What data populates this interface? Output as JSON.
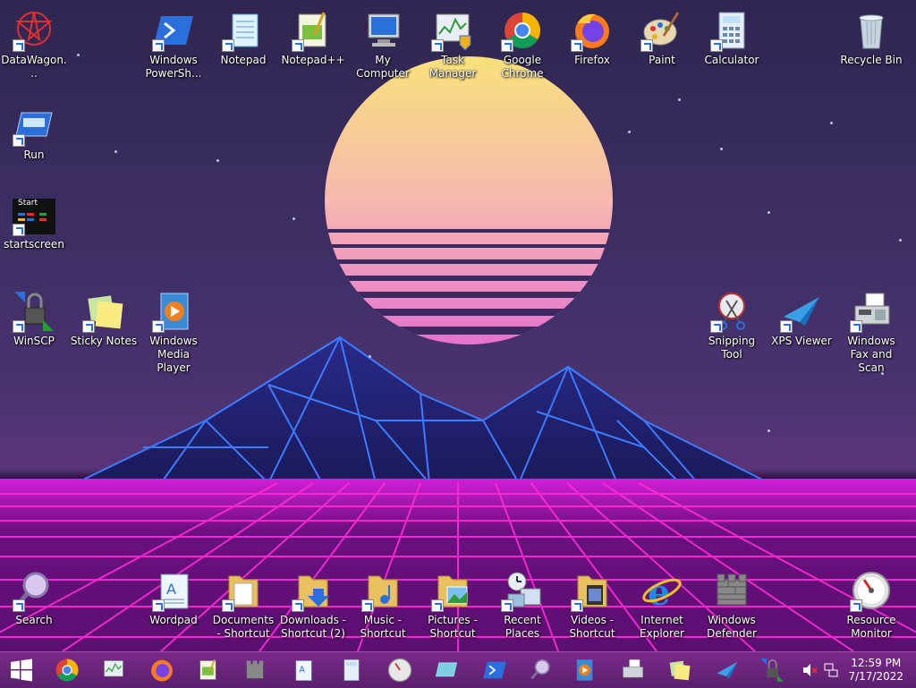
{
  "desktop_icons": [
    {
      "key": "datawagon",
      "label": "DataWagon...",
      "icon": "datawagon-icon"
    },
    {
      "key": "powershell",
      "label": "Windows PowerSh...",
      "icon": "powershell-icon"
    },
    {
      "key": "notepad",
      "label": "Notepad",
      "icon": "notepad-icon"
    },
    {
      "key": "notepadpp",
      "label": "Notepad++",
      "icon": "notepadpp-icon"
    },
    {
      "key": "mycomputer",
      "label": "My Computer",
      "icon": "computer-icon"
    },
    {
      "key": "taskmanager",
      "label": "Task Manager",
      "icon": "task-manager-icon"
    },
    {
      "key": "chrome",
      "label": "Google Chrome",
      "icon": "chrome-icon"
    },
    {
      "key": "firefox",
      "label": "Firefox",
      "icon": "firefox-icon"
    },
    {
      "key": "paint",
      "label": "Paint",
      "icon": "paint-icon"
    },
    {
      "key": "calculator",
      "label": "Calculator",
      "icon": "calculator-icon"
    },
    {
      "key": "recyclebin",
      "label": "Recycle Bin",
      "icon": "recycle-bin-icon"
    },
    {
      "key": "run",
      "label": "Run",
      "icon": "run-icon"
    },
    {
      "key": "startscreen",
      "label": "startscreen",
      "icon": "startscreen-icon"
    },
    {
      "key": "winscp",
      "label": "WinSCP",
      "icon": "winscp-icon"
    },
    {
      "key": "stickynotes",
      "label": "Sticky Notes",
      "icon": "sticky-notes-icon"
    },
    {
      "key": "mediaplayer",
      "label": "Windows Media Player",
      "icon": "media-player-icon"
    },
    {
      "key": "snipping",
      "label": "Snipping Tool",
      "icon": "snipping-tool-icon"
    },
    {
      "key": "xps",
      "label": "XPS Viewer",
      "icon": "xps-viewer-icon"
    },
    {
      "key": "faxscan",
      "label": "Windows Fax and Scan",
      "icon": "fax-scan-icon"
    },
    {
      "key": "search",
      "label": "Search",
      "icon": "search-icon"
    },
    {
      "key": "wordpad",
      "label": "Wordpad",
      "icon": "wordpad-icon"
    },
    {
      "key": "documents",
      "label": "Documents - Shortcut",
      "icon": "folder-documents-icon"
    },
    {
      "key": "downloads",
      "label": "Downloads - Shortcut (2)",
      "icon": "folder-downloads-icon"
    },
    {
      "key": "music",
      "label": "Music - Shortcut",
      "icon": "folder-music-icon"
    },
    {
      "key": "pictures",
      "label": "Pictures - Shortcut",
      "icon": "folder-pictures-icon"
    },
    {
      "key": "recentplaces",
      "label": "Recent Places",
      "icon": "recent-places-icon"
    },
    {
      "key": "videos",
      "label": "Videos - Shortcut",
      "icon": "folder-videos-icon"
    },
    {
      "key": "ie",
      "label": "Internet Explorer",
      "icon": "internet-explorer-icon"
    },
    {
      "key": "defender",
      "label": "Windows Defender",
      "icon": "defender-icon"
    },
    {
      "key": "resmon",
      "label": "Resource Monitor",
      "icon": "resource-monitor-icon"
    }
  ],
  "startscreen_text": "Start",
  "taskbar": {
    "start_icon": "windows-start-icon",
    "pinned": [
      "chrome-icon",
      "task-manager-icon",
      "firefox-icon",
      "notepadpp-icon",
      "defender-icon",
      "wordpad-icon",
      "calculator-icon",
      "resource-monitor-icon",
      "xps-viewer-icon",
      "powershell-icon",
      "search-icon",
      "media-player-icon",
      "fax-scan-icon",
      "sticky-notes-icon",
      "xps-viewer-icon",
      "winscp-icon"
    ],
    "tray": {
      "volume_icon": "volume-muted-icon",
      "network_icon": "network-icon",
      "time": "12:59 PM",
      "date": "7/17/2022"
    }
  },
  "colors": {
    "taskbar": "#6a2479",
    "grid": "#ff2bd6",
    "mountain": "#3d7bff",
    "sun_top": "#f8e27a",
    "sun_bottom": "#e66fd0"
  }
}
